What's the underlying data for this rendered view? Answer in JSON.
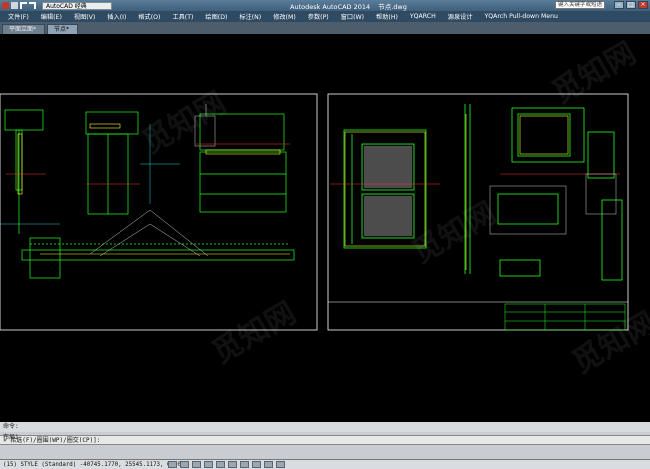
{
  "title_bar": {
    "workspace": "AutoCAD 经典",
    "app_title": "Autodesk AutoCAD 2014",
    "doc_name": "节点.dwg",
    "search_placeholder": "键入关键字或短语"
  },
  "menu": [
    "文件(F)",
    "编辑(E)",
    "视图(V)",
    "插入(I)",
    "格式(O)",
    "工具(T)",
    "绘图(D)",
    "标注(N)",
    "修改(M)",
    "参数(P)",
    "窗口(W)",
    "帮助(H)",
    "YQARCH",
    "源泉设计",
    "YQArch Pull-down Menu"
  ],
  "tabs": [
    {
      "label": "平面立面*"
    },
    {
      "label": "节点*"
    }
  ],
  "command": {
    "line1": "命令:",
    "line2": "× 拾选(F)/圈围(WP)/圈交(CP)]:",
    "model_tab": "布局1"
  },
  "status": {
    "coords": "(15) STYLE (Standard) -40745.1770, 25545.1173, 0.0000"
  },
  "icons": [
    "save-icon",
    "undo-icon",
    "redo-icon",
    "search-icon",
    "minimize-icon",
    "maximize-icon",
    "close-icon"
  ]
}
